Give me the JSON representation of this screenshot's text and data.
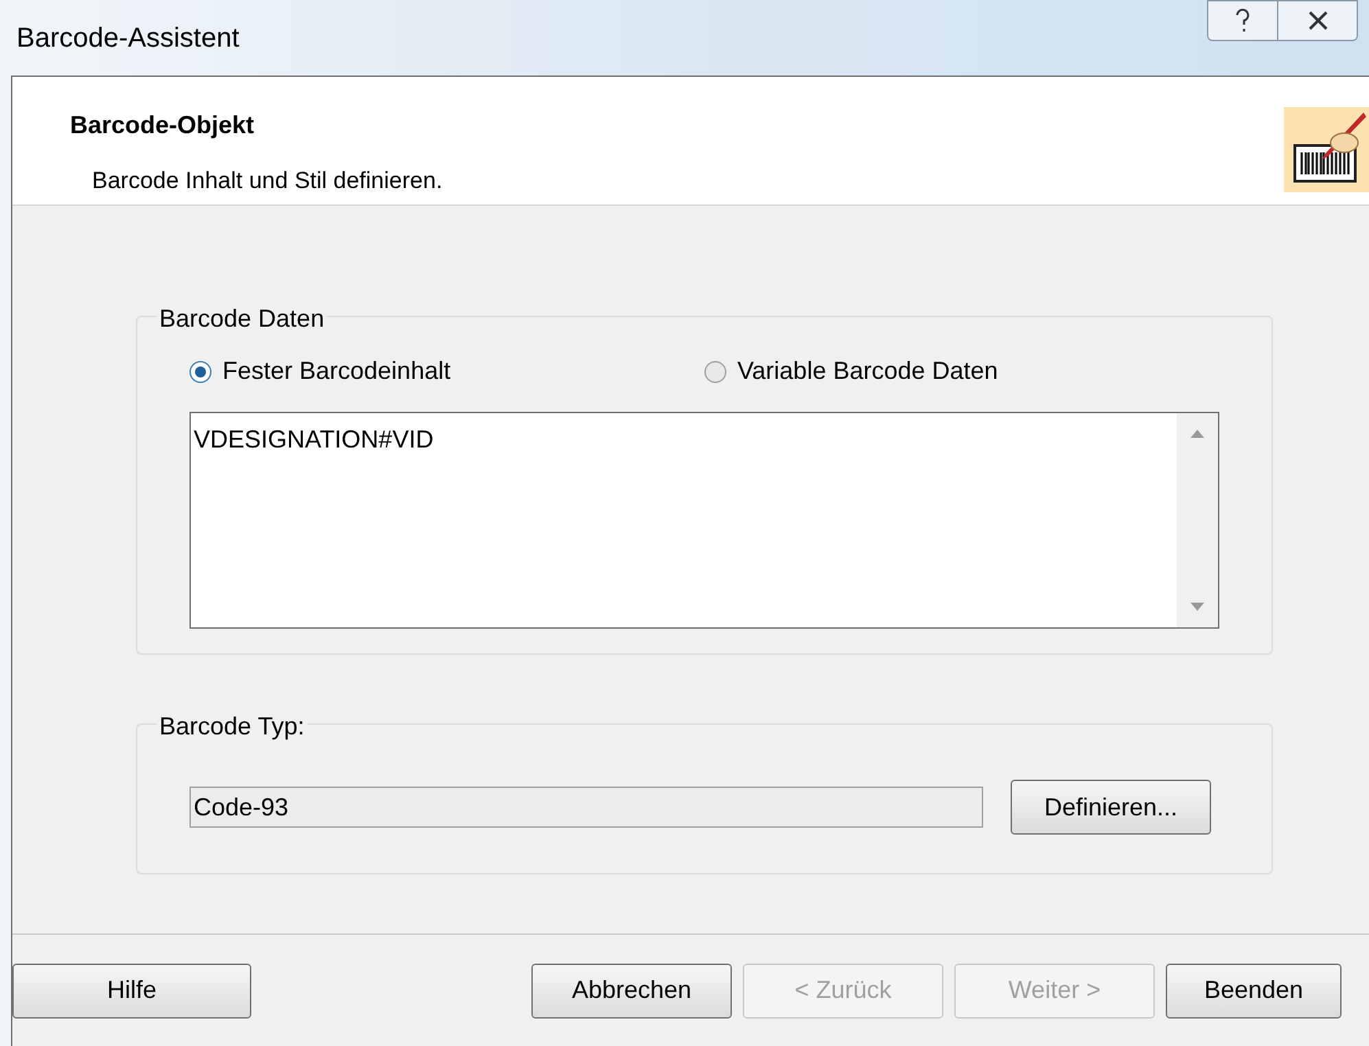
{
  "window": {
    "title": "Barcode-Assistent"
  },
  "header": {
    "title": "Barcode-Objekt",
    "subtitle": "Barcode Inhalt und Stil definieren."
  },
  "data_group": {
    "label": "Barcode Daten",
    "options": [
      {
        "label": "Fester Barcodeinhalt",
        "selected": true
      },
      {
        "label": "Variable Barcode Daten",
        "selected": false
      }
    ],
    "content": "VDESIGNATION#VID"
  },
  "type_group": {
    "label": "Barcode Typ:",
    "value": "Code-93",
    "button": "Definieren..."
  },
  "buttons": [
    {
      "label": "Hilfe",
      "disabled": false
    },
    {
      "label": "Abbrechen",
      "disabled": false
    },
    {
      "label": "< Zurück",
      "disabled": true
    },
    {
      "label": "Weiter >",
      "disabled": true
    },
    {
      "label": "Beenden",
      "disabled": false
    }
  ]
}
